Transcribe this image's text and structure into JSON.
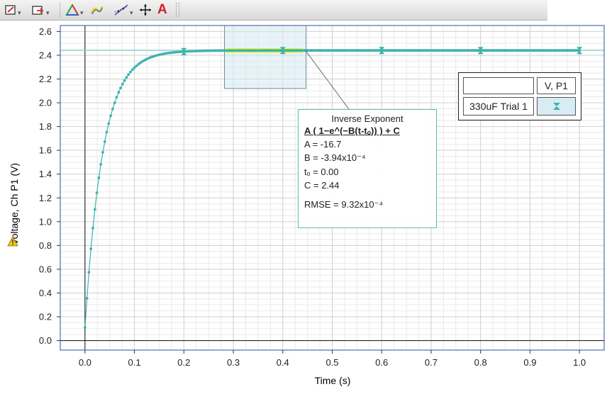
{
  "toolbar": {
    "icons": [
      "graph-options-icon",
      "axis-options-icon",
      "analyze-icon",
      "highlight-icon",
      "fit-icon",
      "examine-icon",
      "annotation-icon"
    ],
    "annotation_glyph": "A"
  },
  "chart_data": {
    "type": "scatter",
    "xlabel": "Time (s)",
    "ylabel": "Voltage, Ch P1 (V)",
    "xlim": [
      -0.05,
      1.05
    ],
    "ylim": [
      -0.08,
      2.65
    ],
    "x_ticks": [
      "0.0",
      "0.1",
      "0.2",
      "0.3",
      "0.4",
      "0.5",
      "0.6",
      "0.7",
      "0.8",
      "0.9",
      "1.0"
    ],
    "y_ticks": [
      "0.0",
      "0.2",
      "0.4",
      "0.6",
      "0.8",
      "1.0",
      "1.2",
      "1.4",
      "1.6",
      "1.8",
      "2.0",
      "2.2",
      "2.4",
      "2.6"
    ],
    "grid": true,
    "series": [
      {
        "name": "330uF Trial 1",
        "color": "#3bb3ad",
        "x_start": 0.0,
        "x_end": 1.0,
        "dx": 0.004,
        "model": {
          "A": 2.44,
          "tau": 0.036,
          "y0": 0.11
        },
        "points": [
          [
            0.0,
            0.11
          ],
          [
            0.01,
            0.73
          ],
          [
            0.02,
            1.22
          ],
          [
            0.03,
            1.59
          ],
          [
            0.04,
            1.86
          ],
          [
            0.05,
            2.05
          ],
          [
            0.06,
            2.19
          ],
          [
            0.08,
            2.33
          ],
          [
            0.1,
            2.4
          ],
          [
            0.15,
            2.43
          ],
          [
            0.2,
            2.43
          ],
          [
            0.3,
            2.44
          ],
          [
            0.4,
            2.44
          ],
          [
            0.5,
            2.445
          ],
          [
            0.6,
            2.45
          ],
          [
            0.7,
            2.45
          ],
          [
            0.8,
            2.45
          ],
          [
            0.9,
            2.45
          ],
          [
            1.0,
            2.45
          ]
        ],
        "marker_every_x": 0.2
      }
    ],
    "fit_line_y": 2.44,
    "selection_x": [
      0.282,
      0.447
    ],
    "selection_y": [
      2.12,
      2.65
    ],
    "highlight_x": [
      0.285,
      0.445
    ],
    "fit_box": {
      "title": "Inverse Exponent",
      "formula": "A ( 1−e^(−B(t-tₒ)) ) + C",
      "lines": [
        "A = -16.7",
        "B = -3.94x10⁻⁴",
        "tₒ = 0.00",
        "C = 2.44"
      ],
      "rmse": "RMSE = 9.32x10⁻⁴"
    },
    "legend": {
      "column_header": "V, P1",
      "row_label": "330uF Trial 1",
      "position": "top-right"
    },
    "colors": {
      "series": "#3bb3ad",
      "highlight": "#e6f01c",
      "selection_fill": "#d5eaf2",
      "grid_minor": "#eaeaea",
      "grid_major": "#cfcfcf",
      "border": "#4a6fb5"
    }
  }
}
